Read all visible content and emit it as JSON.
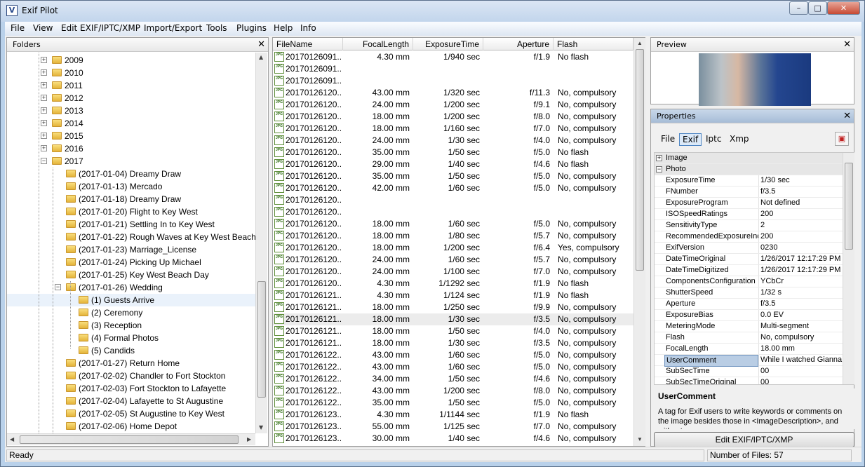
{
  "window": {
    "title": "Exif Pilot",
    "min": "–",
    "max": "□",
    "close": "✕"
  },
  "menu": [
    "File",
    "View",
    "Edit EXIF/IPTC/XMP",
    "Import/Export",
    "Tools",
    "Plugins",
    "Help",
    "Info"
  ],
  "folders": {
    "title": "Folders",
    "close": "✕",
    "items": [
      {
        "label": "2009",
        "level": 0,
        "expander": "+"
      },
      {
        "label": "2010",
        "level": 0,
        "expander": "+"
      },
      {
        "label": "2011",
        "level": 0,
        "expander": "+"
      },
      {
        "label": "2012",
        "level": 0,
        "expander": "+"
      },
      {
        "label": "2013",
        "level": 0,
        "expander": "+"
      },
      {
        "label": "2014",
        "level": 0,
        "expander": "+"
      },
      {
        "label": "2015",
        "level": 0,
        "expander": "+"
      },
      {
        "label": "2016",
        "level": 0,
        "expander": "+"
      },
      {
        "label": "2017",
        "level": 0,
        "expander": "−"
      },
      {
        "label": "(2017-01-04) Dreamy Draw",
        "level": 1,
        "expander": ""
      },
      {
        "label": "(2017-01-13) Mercado",
        "level": 1,
        "expander": ""
      },
      {
        "label": "(2017-01-18) Dreamy Draw",
        "level": 1,
        "expander": ""
      },
      {
        "label": "(2017-01-20) Flight to Key West",
        "level": 1,
        "expander": ""
      },
      {
        "label": "(2017-01-21) Settling In to Key West",
        "level": 1,
        "expander": ""
      },
      {
        "label": "(2017-01-22) Rough Waves at Key West Beach",
        "level": 1,
        "expander": ""
      },
      {
        "label": "(2017-01-23) Marriage_License",
        "level": 1,
        "expander": ""
      },
      {
        "label": "(2017-01-24) Picking Up Michael",
        "level": 1,
        "expander": ""
      },
      {
        "label": "(2017-01-25) Key West Beach Day",
        "level": 1,
        "expander": ""
      },
      {
        "label": "(2017-01-26) Wedding",
        "level": 1,
        "expander": "−"
      },
      {
        "label": "(1) Guests Arrive",
        "level": 2,
        "expander": ""
      },
      {
        "label": "(2) Ceremony",
        "level": 2,
        "expander": ""
      },
      {
        "label": "(3) Reception",
        "level": 2,
        "expander": ""
      },
      {
        "label": "(4) Formal Photos",
        "level": 2,
        "expander": ""
      },
      {
        "label": "(5) Candids",
        "level": 2,
        "expander": ""
      },
      {
        "label": "(2017-01-27) Return Home",
        "level": 1,
        "expander": ""
      },
      {
        "label": "(2017-02-02) Chandler to Fort Stockton",
        "level": 1,
        "expander": ""
      },
      {
        "label": "(2017-02-03) Fort Stockton to Lafayette",
        "level": 1,
        "expander": ""
      },
      {
        "label": "(2017-02-04) Lafayette to St Augustine",
        "level": 1,
        "expander": ""
      },
      {
        "label": "(2017-02-05) St Augustine to Key West",
        "level": 1,
        "expander": ""
      },
      {
        "label": "(2017-02-06) Home Depot",
        "level": 1,
        "expander": ""
      }
    ]
  },
  "files": {
    "columns": [
      "FileName",
      "FocalLength",
      "ExposureTime",
      "Aperture",
      "Flash"
    ],
    "icon_label": "JPG",
    "rows": [
      [
        "20170126091...",
        "4.30 mm",
        "1/940 sec",
        "f/1.9",
        "No flash"
      ],
      [
        "20170126091...",
        "",
        "",
        "",
        ""
      ],
      [
        "20170126091...",
        "",
        "",
        "",
        ""
      ],
      [
        "20170126120...",
        "43.00 mm",
        "1/320 sec",
        "f/11.3",
        "No, compulsory"
      ],
      [
        "20170126120...",
        "24.00 mm",
        "1/200 sec",
        "f/9.1",
        "No, compulsory"
      ],
      [
        "20170126120...",
        "18.00 mm",
        "1/200 sec",
        "f/8.0",
        "No, compulsory"
      ],
      [
        "20170126120...",
        "18.00 mm",
        "1/160 sec",
        "f/7.0",
        "No, compulsory"
      ],
      [
        "20170126120...",
        "24.00 mm",
        "1/30 sec",
        "f/4.0",
        "No, compulsory"
      ],
      [
        "20170126120...",
        "35.00 mm",
        "1/50 sec",
        "f/5.0",
        "No flash"
      ],
      [
        "20170126120...",
        "29.00 mm",
        "1/40 sec",
        "f/4.6",
        "No flash"
      ],
      [
        "20170126120...",
        "35.00 mm",
        "1/50 sec",
        "f/5.0",
        "No, compulsory"
      ],
      [
        "20170126120...",
        "42.00 mm",
        "1/60 sec",
        "f/5.0",
        "No, compulsory"
      ],
      [
        "20170126120...",
        "",
        "",
        "",
        ""
      ],
      [
        "20170126120...",
        "",
        "",
        "",
        ""
      ],
      [
        "20170126120...",
        "18.00 mm",
        "1/60 sec",
        "f/5.0",
        "No, compulsory"
      ],
      [
        "20170126120...",
        "18.00 mm",
        "1/80 sec",
        "f/5.7",
        "No, compulsory"
      ],
      [
        "20170126120...",
        "18.00 mm",
        "1/200 sec",
        "f/6.4",
        "Yes, compulsory"
      ],
      [
        "20170126120...",
        "24.00 mm",
        "1/60 sec",
        "f/5.7",
        "No, compulsory"
      ],
      [
        "20170126120...",
        "24.00 mm",
        "1/100 sec",
        "f/7.0",
        "No, compulsory"
      ],
      [
        "20170126120...",
        "4.30 mm",
        "1/1292 sec",
        "f/1.9",
        "No flash"
      ],
      [
        "20170126121...",
        "4.30 mm",
        "1/124 sec",
        "f/1.9",
        "No flash"
      ],
      [
        "20170126121...",
        "18.00 mm",
        "1/250 sec",
        "f/9.9",
        "No, compulsory"
      ],
      [
        "20170126121...",
        "18.00 mm",
        "1/30 sec",
        "f/3.5",
        "No, compulsory"
      ],
      [
        "20170126121...",
        "18.00 mm",
        "1/50 sec",
        "f/4.0",
        "No, compulsory"
      ],
      [
        "20170126121...",
        "18.00 mm",
        "1/30 sec",
        "f/3.5",
        "No, compulsory"
      ],
      [
        "20170126122...",
        "43.00 mm",
        "1/60 sec",
        "f/5.0",
        "No, compulsory"
      ],
      [
        "20170126122...",
        "43.00 mm",
        "1/60 sec",
        "f/5.0",
        "No, compulsory"
      ],
      [
        "20170126122...",
        "34.00 mm",
        "1/50 sec",
        "f/4.6",
        "No, compulsory"
      ],
      [
        "20170126122...",
        "43.00 mm",
        "1/200 sec",
        "f/8.0",
        "No, compulsory"
      ],
      [
        "20170126122...",
        "35.00 mm",
        "1/50 sec",
        "f/5.0",
        "No, compulsory"
      ],
      [
        "20170126123...",
        "4.30 mm",
        "1/1144 sec",
        "f/1.9",
        "No flash"
      ],
      [
        "20170126123...",
        "55.00 mm",
        "1/125 sec",
        "f/7.0",
        "No, compulsory"
      ],
      [
        "20170126123...",
        "30.00 mm",
        "1/40 sec",
        "f/4.6",
        "No, compulsory"
      ]
    ]
  },
  "preview": {
    "title": "Preview",
    "close": "✕"
  },
  "properties": {
    "title": "Properties",
    "close": "✕",
    "tabs": [
      "File",
      "Exif",
      "Iptc",
      "Xmp"
    ],
    "rows": [
      {
        "k": "Image",
        "v": "",
        "cat": true,
        "box": "+"
      },
      {
        "k": "Photo",
        "v": "",
        "cat": true,
        "box": "−"
      },
      {
        "k": "ExposureTime",
        "v": "1/30 sec"
      },
      {
        "k": "FNumber",
        "v": "f/3.5"
      },
      {
        "k": "ExposureProgram",
        "v": "Not defined"
      },
      {
        "k": "ISOSpeedRatings",
        "v": "200"
      },
      {
        "k": "SensitivityType",
        "v": "2"
      },
      {
        "k": "RecommendedExposureInd",
        "v": "200"
      },
      {
        "k": "ExifVersion",
        "v": "0230"
      },
      {
        "k": "DateTimeOriginal",
        "v": "1/26/2017 12:17:29 PM"
      },
      {
        "k": "DateTimeDigitized",
        "v": "1/26/2017 12:17:29 PM"
      },
      {
        "k": "ComponentsConfiguration",
        "v": "YCbCr"
      },
      {
        "k": "ShutterSpeed",
        "v": "1/32 s"
      },
      {
        "k": "Aperture",
        "v": "f/3.5"
      },
      {
        "k": "ExposureBias",
        "v": "0.0 EV"
      },
      {
        "k": "MeteringMode",
        "v": "Multi-segment"
      },
      {
        "k": "Flash",
        "v": "No, compulsory"
      },
      {
        "k": "FocalLength",
        "v": "18.00 mm"
      },
      {
        "k": "UserComment",
        "v": "While I watched Gianna,",
        "sel": true
      },
      {
        "k": "SubSecTime",
        "v": "00"
      },
      {
        "k": "SubSecTimeOriginal",
        "v": "00"
      }
    ],
    "desc_title": "UserComment",
    "desc_text": "A tag for Exif users to write keywords or comments on the image besides those in <ImageDescription>, and without",
    "edit_button": "Edit EXIF/IPTC/XMP"
  },
  "status": {
    "left": "Ready",
    "right": "Number of Files: 57"
  }
}
